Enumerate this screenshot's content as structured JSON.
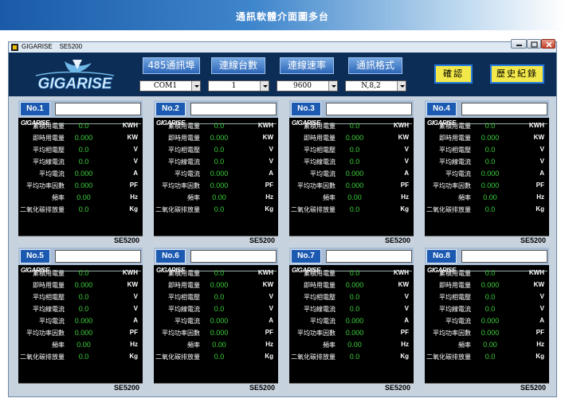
{
  "banner": {
    "title": "通訊軟體介面圖多台"
  },
  "window": {
    "title": "GIGARISE    SE5200"
  },
  "logo": {
    "text": "GIGARISE"
  },
  "toolbar": {
    "buttons": [
      "485通訊埠",
      "連線台數",
      "連線速率",
      "通訊格式"
    ],
    "selects": [
      "COM1",
      "1",
      "9600",
      "N,8,2"
    ],
    "confirm_label": "確認",
    "history_label": "歷史紀錄"
  },
  "panel": {
    "brand": "GIGARISE",
    "model": "SE5200",
    "labels": [
      "No.1",
      "No.2",
      "No.3",
      "No.4",
      "No.5",
      "No.6",
      "No.7",
      "No.8"
    ],
    "rows": [
      {
        "name": "累積用電量",
        "value": "0.0",
        "unit": "KWH"
      },
      {
        "name": "即時用電量",
        "value": "0.000",
        "unit": "KW"
      },
      {
        "name": "平均相電壓",
        "value": "0.0",
        "unit": "V"
      },
      {
        "name": "平均線電流",
        "value": "0.0",
        "unit": "V"
      },
      {
        "name": "平均電流",
        "value": "0.000",
        "unit": "A"
      },
      {
        "name": "平均功率因數",
        "value": "0.000",
        "unit": "PF"
      },
      {
        "name": "頻率",
        "value": "0.00",
        "unit": "Hz"
      },
      {
        "name": "二氧化碳排放量",
        "value": "0.0",
        "unit": "Kg"
      }
    ]
  },
  "colors": {
    "toolbar_bg": "#0c2d56",
    "value_green": "#3bd23b",
    "panel_label_blue": "#1c5ab2",
    "confirm_yellow": "#f2e84a"
  }
}
